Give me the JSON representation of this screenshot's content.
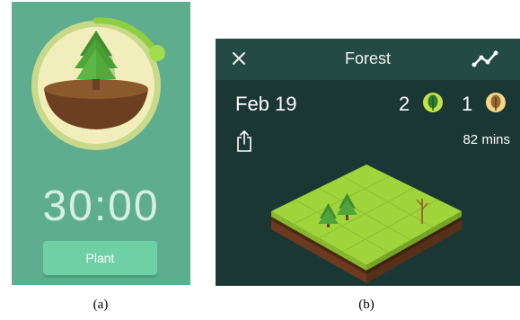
{
  "panel_a": {
    "timer": "30:00",
    "plant_button_label": "Plant",
    "caption": "(a)",
    "colors": {
      "background": "#5fad8f",
      "ring": "#d5e39a",
      "progress": "#9bd64a",
      "tree": "#4fa53a",
      "pot": "#6b3f20"
    }
  },
  "panel_b": {
    "title": "Forest",
    "date": "Feb 19",
    "healthy_count": "2",
    "dead_count": "1",
    "minutes": "82 mins",
    "caption": "(b)",
    "icons": [
      "close-icon",
      "trend-icon",
      "healthy-tree-icon",
      "dead-tree-icon",
      "share-icon"
    ],
    "colors": {
      "header": "#234a43",
      "background": "#1b3733",
      "grass": "#9fd43a",
      "soil": "#6b3a1f"
    }
  }
}
